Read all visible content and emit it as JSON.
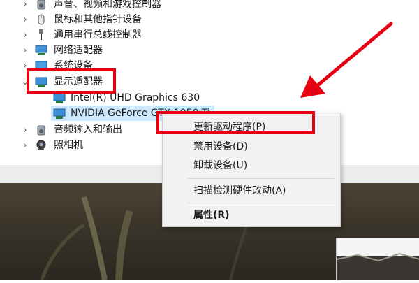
{
  "device_tree": {
    "items": [
      {
        "label": "声音、视频和游戏控制器",
        "icon": "speaker-icon"
      },
      {
        "label": "鼠标和其他指针设备",
        "icon": "mouse-icon"
      },
      {
        "label": "通用串行总线控制器",
        "icon": "usb-icon"
      },
      {
        "label": "网络适配器",
        "icon": "network-adapter-icon"
      },
      {
        "label": "系统设备",
        "icon": "system-device-icon"
      },
      {
        "label": "显示适配器",
        "icon": "display-adapter-icon",
        "expanded": true
      },
      {
        "label": "Intel(R) UHD Graphics 630",
        "icon": "display-adapter-icon"
      },
      {
        "label": "NVIDIA GeForce GTX 1050 Ti",
        "icon": "display-adapter-icon",
        "selected": true
      },
      {
        "label": "音频输入和输出",
        "icon": "audio-io-icon"
      },
      {
        "label": "照相机",
        "icon": "camera-icon"
      }
    ]
  },
  "context_menu": {
    "items": [
      {
        "label": "更新驱动程序(P)"
      },
      {
        "label": "禁用设备(D)"
      },
      {
        "label": "卸载设备(U)"
      },
      {
        "label": "扫描检测硬件改动(A)"
      },
      {
        "label": "属性(R)",
        "bold": true
      }
    ]
  },
  "colors": {
    "annotation_red": "#e60012",
    "selection_blue": "#cce8ff",
    "menu_background": "#f2f2f2"
  }
}
